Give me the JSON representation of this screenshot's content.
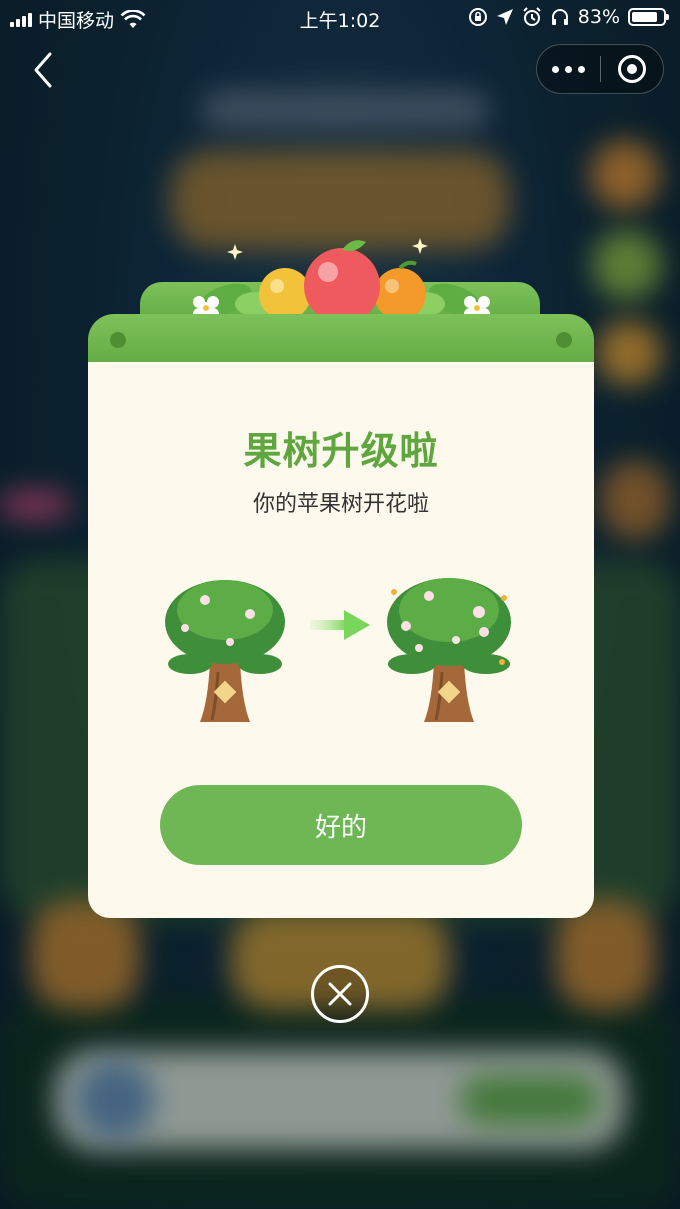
{
  "status_bar": {
    "carrier": "中国移动",
    "time": "上午1:02",
    "battery_percent": "83%",
    "battery_level": 0.83
  },
  "nav": {
    "back_icon": "chevron-left-icon",
    "more_icon": "more-dots-icon",
    "close_icon": "target-circle-icon"
  },
  "dialog": {
    "title": "果树升级啦",
    "subtitle": "你的苹果树开花啦",
    "before_icon": "tree-icon",
    "after_icon": "flowering-tree-icon",
    "ok_label": "好的",
    "close_icon": "close-circle-icon"
  },
  "colors": {
    "accent_green": "#6fb655",
    "title_green": "#5ea63e",
    "dialog_bg": "#fdf9ec"
  }
}
